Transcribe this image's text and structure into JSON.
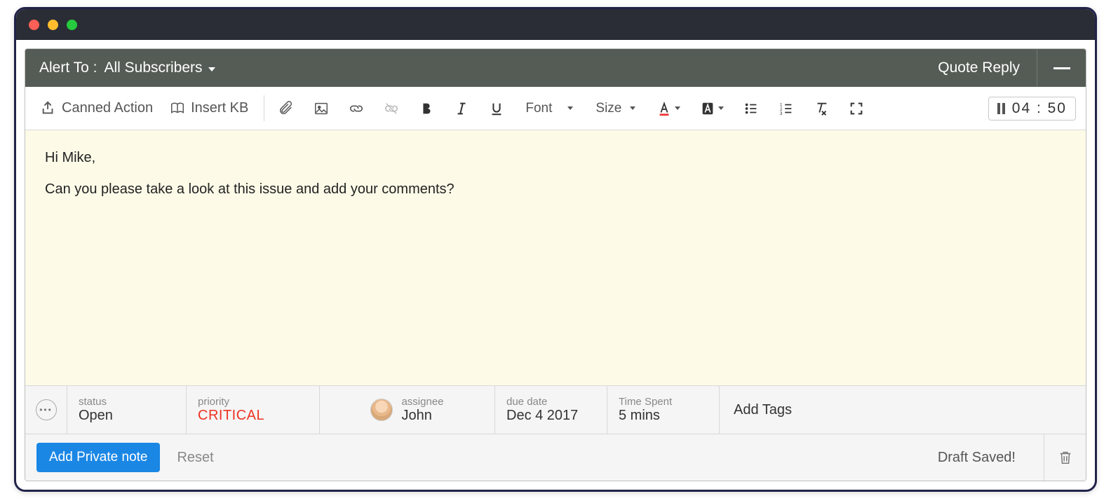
{
  "header": {
    "alert_label": "Alert To :",
    "alert_value": "All Subscribers",
    "quote_reply": "Quote Reply"
  },
  "toolbar": {
    "canned_action": "Canned Action",
    "insert_kb": "Insert KB",
    "font_label": "Font",
    "size_label": "Size",
    "timer": "04 : 50"
  },
  "editor": {
    "line1": "Hi Mike,",
    "line2": "Can you please take a look at this issue and add your comments?"
  },
  "meta": {
    "status_label": "status",
    "status_value": "Open",
    "priority_label": "priority",
    "priority_value": "CRITICAL",
    "assignee_label": "assignee",
    "assignee_value": "John",
    "due_label": "due date",
    "due_value": "Dec 4 2017",
    "time_label": "Time Spent",
    "time_value": "5 mins",
    "tags_placeholder": "Add Tags"
  },
  "footer": {
    "add_note": "Add Private note",
    "reset": "Reset",
    "draft_saved": "Draft Saved!"
  }
}
